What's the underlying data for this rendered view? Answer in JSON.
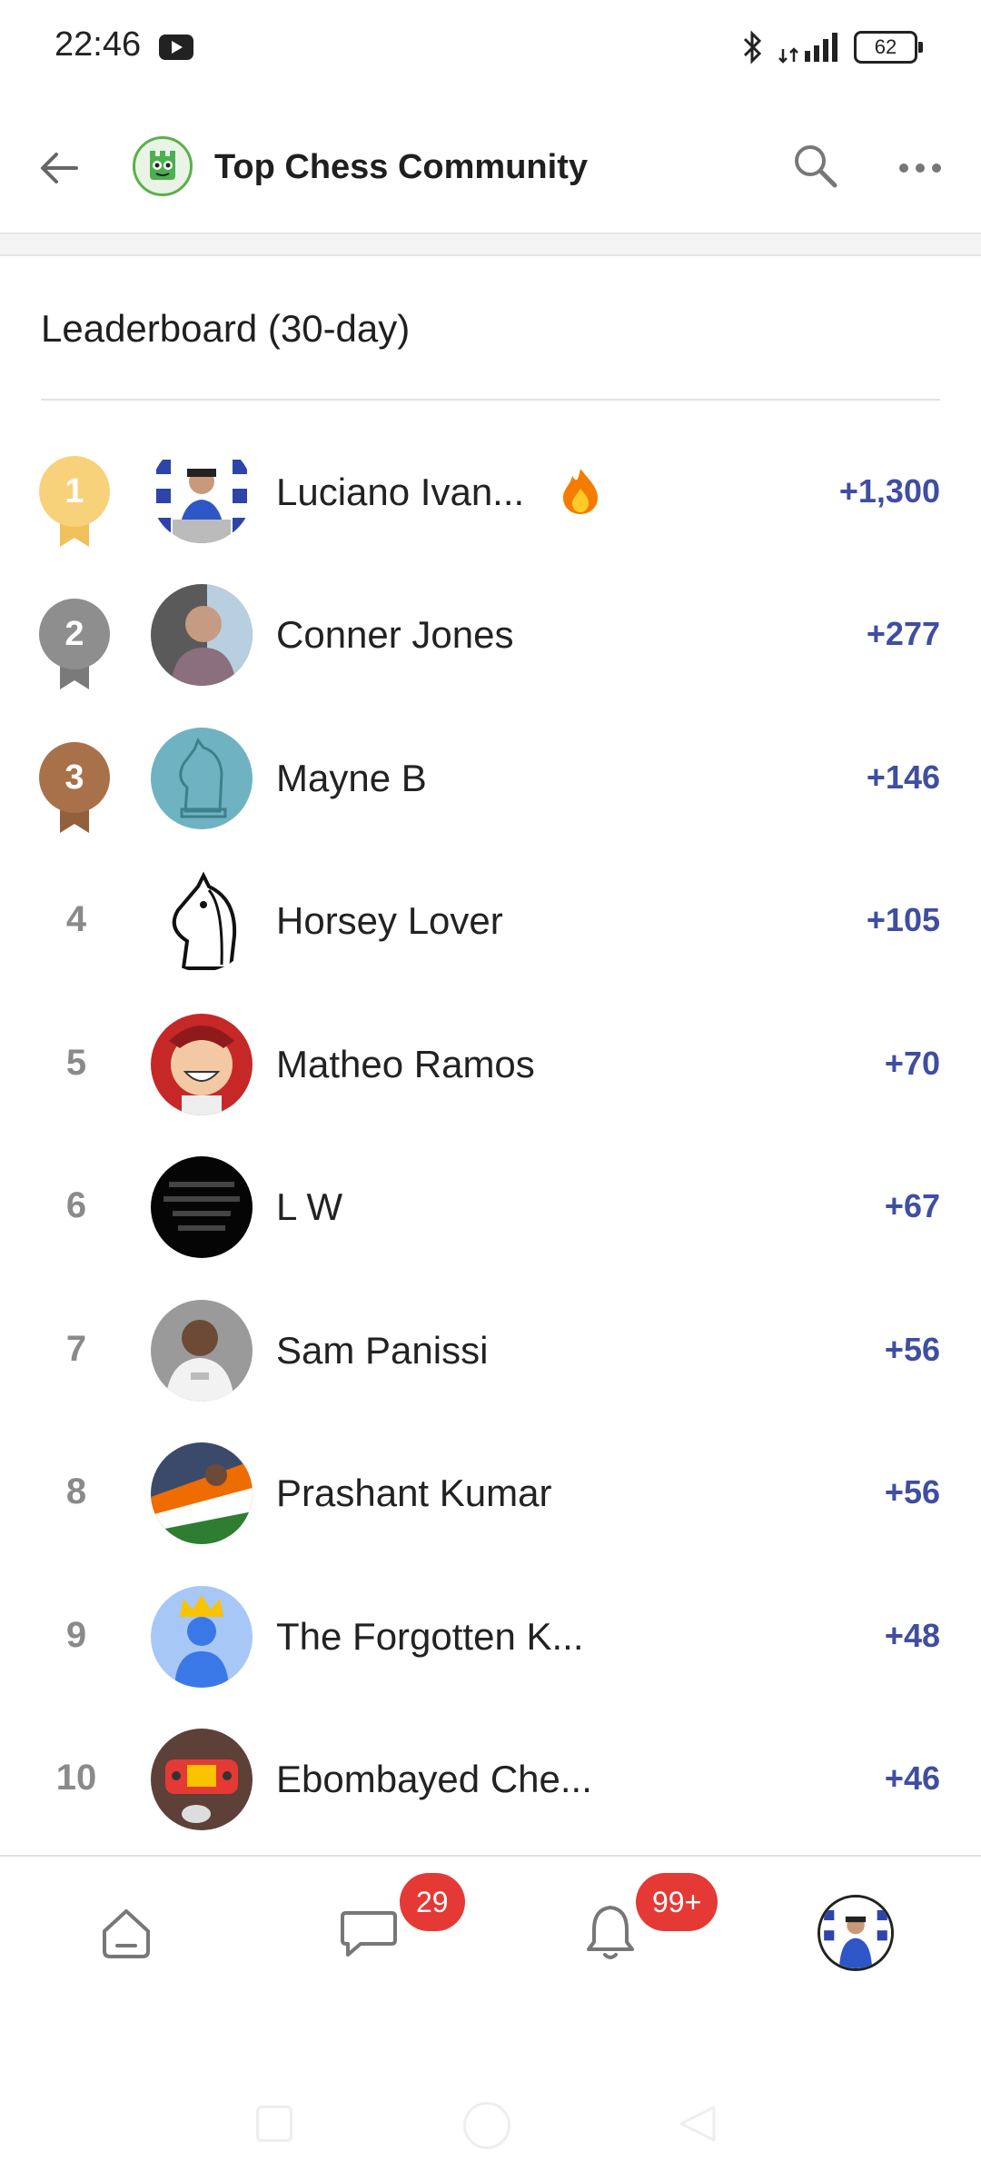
{
  "status_bar": {
    "time": "22:46",
    "network": "4G+",
    "battery": "62",
    "icons": [
      "youtube-icon",
      "bluetooth-icon",
      "signal-icon",
      "battery-icon"
    ]
  },
  "header": {
    "title": "Top Chess Community",
    "icons": [
      "back-arrow-icon",
      "community-logo",
      "search-icon",
      "more-options-icon"
    ]
  },
  "leaderboard": {
    "title": "Leaderboard (30-day)",
    "rows": [
      {
        "rank": "1",
        "name": "Luciano Ivan...",
        "points": "+1,300",
        "fire": true
      },
      {
        "rank": "2",
        "name": "Conner Jones",
        "points": "+277"
      },
      {
        "rank": "3",
        "name": "Mayne B",
        "points": "+146"
      },
      {
        "rank": "4",
        "name": "Horsey Lover",
        "points": "+105"
      },
      {
        "rank": "5",
        "name": "Matheo Ramos",
        "points": "+70"
      },
      {
        "rank": "6",
        "name": "L W",
        "points": "+67"
      },
      {
        "rank": "7",
        "name": "Sam Panissi",
        "points": "+56"
      },
      {
        "rank": "8",
        "name": "Prashant Kumar",
        "points": "+56"
      },
      {
        "rank": "9",
        "name": "The Forgotten K...",
        "points": "+48"
      },
      {
        "rank": "10",
        "name": "Ebombayed Che...",
        "points": "+46"
      }
    ]
  },
  "bottom_nav": {
    "items": [
      {
        "name": "home",
        "icon": "home-icon"
      },
      {
        "name": "chats",
        "icon": "chat-icon",
        "badge": "29"
      },
      {
        "name": "notifications",
        "icon": "bell-icon",
        "badge": "99+"
      },
      {
        "name": "profile",
        "icon": "profile-avatar"
      }
    ]
  },
  "colors": {
    "accent_points": "#3f4ea0",
    "gold": "#f7d27b",
    "silver": "#8e8e8e",
    "bronze": "#a8714a",
    "badge": "#e53935"
  }
}
